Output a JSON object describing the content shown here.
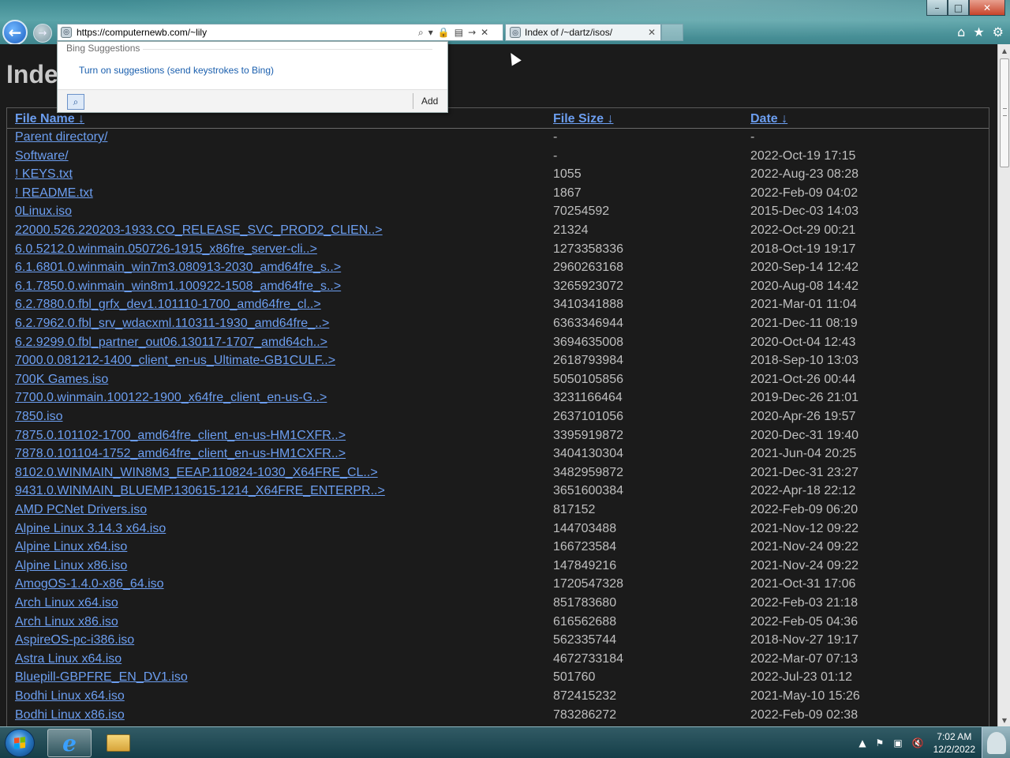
{
  "browser": {
    "address_value": "https://computernewb.com/~lily",
    "tab_title": "Index of /~dartz/isos/",
    "window_buttons": [
      "–",
      "□",
      "✕"
    ]
  },
  "suggestions": {
    "title": "Bing Suggestions",
    "link": "Turn on suggestions (send keystrokes to Bing)",
    "add_label": "Add"
  },
  "page": {
    "title": "Inde",
    "columns": [
      "File Name",
      "File Size",
      "Date"
    ],
    "sort_arrow": "↓",
    "rows": [
      [
        "Parent directory/",
        "-",
        "-"
      ],
      [
        "Software/",
        "-",
        "2022-Oct-19 17:15"
      ],
      [
        "! KEYS.txt",
        "1055",
        "2022-Aug-23 08:28"
      ],
      [
        "! README.txt",
        "1867",
        "2022-Feb-09 04:02"
      ],
      [
        "0Linux.iso",
        "70254592",
        "2015-Dec-03 14:03"
      ],
      [
        "22000.526.220203-1933.CO_RELEASE_SVC_PROD2_CLIEN..>",
        "21324",
        "2022-Oct-29 00:21"
      ],
      [
        "6.0.5212.0.winmain.050726-1915_x86fre_server-cli..>",
        "1273358336",
        "2018-Oct-19 19:17"
      ],
      [
        "6.1.6801.0.winmain_win7m3.080913-2030_amd64fre_s..>",
        "2960263168",
        "2020-Sep-14 12:42"
      ],
      [
        "6.1.7850.0.winmain_win8m1.100922-1508_amd64fre_s..>",
        "3265923072",
        "2020-Aug-08 14:42"
      ],
      [
        "6.2.7880.0.fbl_grfx_dev1.101110-1700_amd64fre_cl..>",
        "3410341888",
        "2021-Mar-01 11:04"
      ],
      [
        "6.2.7962.0.fbl_srv_wdacxml.110311-1930_amd64fre_..>",
        "6363346944",
        "2021-Dec-11 08:19"
      ],
      [
        "6.2.9299.0.fbl_partner_out06.130117-1707_amd64ch..>",
        "3694635008",
        "2020-Oct-04 12:43"
      ],
      [
        "7000.0.081212-1400_client_en-us_Ultimate-GB1CULF..>",
        "2618793984",
        "2018-Sep-10 13:03"
      ],
      [
        "700K Games.iso",
        "5050105856",
        "2021-Oct-26 00:44"
      ],
      [
        "7700.0.winmain.100122-1900_x64fre_client_en-us-G..>",
        "3231166464",
        "2019-Dec-26 21:01"
      ],
      [
        "7850.iso",
        "2637101056",
        "2020-Apr-26 19:57"
      ],
      [
        "7875.0.101102-1700_amd64fre_client_en-us-HM1CXFR..>",
        "3395919872",
        "2020-Dec-31 19:40"
      ],
      [
        "7878.0.101104-1752_amd64fre_client_en-us-HM1CXFR..>",
        "3404130304",
        "2021-Jun-04 20:25"
      ],
      [
        "8102.0.WINMAIN_WIN8M3_EEAP.110824-1030_X64FRE_CL..>",
        "3482959872",
        "2021-Dec-31 23:27"
      ],
      [
        "9431.0.WINMAIN_BLUEMP.130615-1214_X64FRE_ENTERPR..>",
        "3651600384",
        "2022-Apr-18 22:12"
      ],
      [
        "AMD PCNet Drivers.iso",
        "817152",
        "2022-Feb-09 06:20"
      ],
      [
        "Alpine Linux 3.14.3 x64.iso",
        "144703488",
        "2021-Nov-12 09:22"
      ],
      [
        "Alpine Linux x64.iso",
        "166723584",
        "2021-Nov-24 09:22"
      ],
      [
        "Alpine Linux x86.iso",
        "147849216",
        "2021-Nov-24 09:22"
      ],
      [
        "AmogOS-1.4.0-x86_64.iso",
        "1720547328",
        "2021-Oct-31 17:06"
      ],
      [
        "Arch Linux x64.iso",
        "851783680",
        "2022-Feb-03 21:18"
      ],
      [
        "Arch Linux x86.iso",
        "616562688",
        "2022-Feb-05 04:36"
      ],
      [
        "AspireOS-pc-i386.iso",
        "562335744",
        "2018-Nov-27 19:17"
      ],
      [
        "Astra Linux x64.iso",
        "4672733184",
        "2022-Mar-07 07:13"
      ],
      [
        "Bluepill-GBPFRE_EN_DV1.iso",
        "501760",
        "2022-Jul-23 01:12"
      ],
      [
        "Bodhi Linux x64.iso",
        "872415232",
        "2021-May-10 15:26"
      ],
      [
        "Bodhi Linux x86.iso",
        "783286272",
        "2022-Feb-09 02:38"
      ]
    ]
  },
  "taskbar": {
    "time": "7:02 AM",
    "date": "12/2/2022"
  }
}
